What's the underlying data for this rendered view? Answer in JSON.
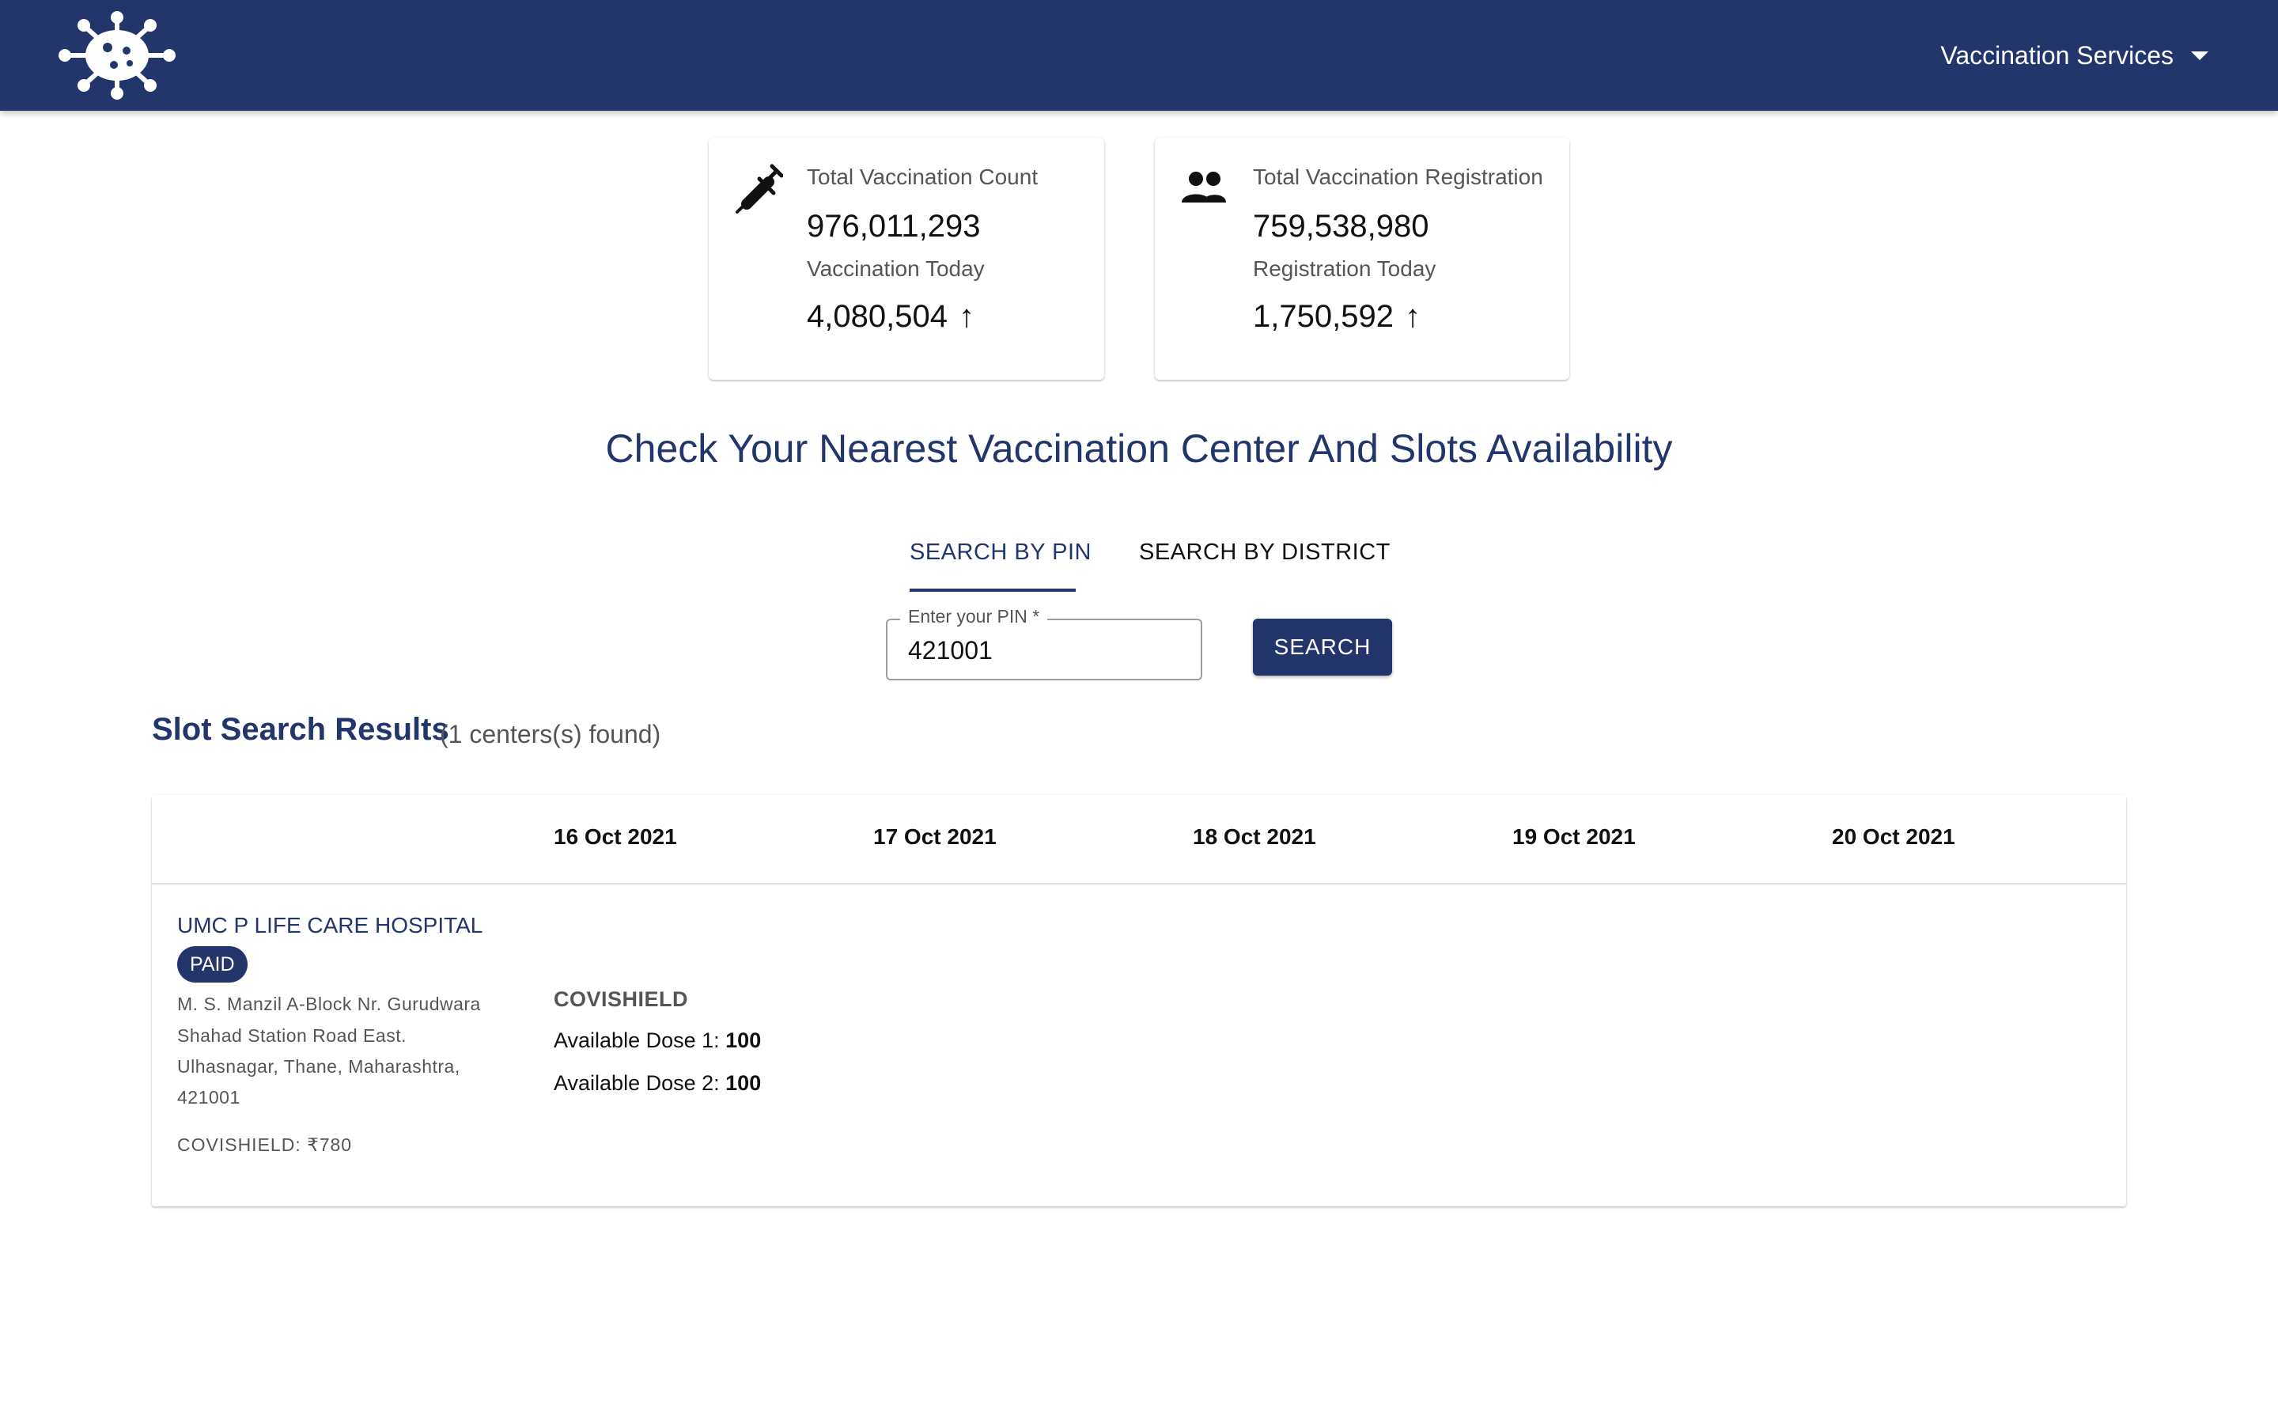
{
  "header": {
    "menu_label": "Vaccination Services"
  },
  "stats": {
    "vaccination": {
      "total_label": "Total Vaccination Count",
      "total_value": "976,011,293",
      "today_label": "Vaccination Today",
      "today_value": "4,080,504",
      "icon": "syringe-icon"
    },
    "registration": {
      "total_label": "Total Vaccination Registration",
      "total_value": "759,538,980",
      "today_label": "Registration Today",
      "today_value": "1,750,592",
      "icon": "people-icon"
    },
    "trend_icon": "↑"
  },
  "search": {
    "heading": "Check Your Nearest Vaccination Center And Slots Availability",
    "tabs": [
      {
        "label": "SEARCH BY PIN",
        "active": true
      },
      {
        "label": "SEARCH BY DISTRICT",
        "active": false
      }
    ],
    "pin_label": "Enter your PIN *",
    "pin_value": "421001",
    "button_label": "SEARCH"
  },
  "results": {
    "title": "Slot Search Results",
    "count_text": "(1 centers(s) found)",
    "dates": [
      "16 Oct 2021",
      "17 Oct 2021",
      "18 Oct 2021",
      "19 Oct 2021",
      "20 Oct 2021"
    ],
    "center": {
      "name": "UMC P LIFE CARE HOSPITAL",
      "badge": "PAID",
      "address_lines": [
        "M. S. Manzil A-Block Nr. Gurudwara",
        "Shahad Station Road East.",
        "Ulhasnagar, Thane, Maharashtra,",
        "421001"
      ],
      "fee": "COVISHIELD: ₹780",
      "slot": {
        "vaccine": "COVISHIELD",
        "dose1_label": "Available Dose 1:",
        "dose1_value": "100",
        "dose2_label": "Available Dose 2:",
        "dose2_value": "100"
      }
    }
  },
  "colors": {
    "primary": "#22366b",
    "text": "#212121",
    "muted": "#555555"
  }
}
